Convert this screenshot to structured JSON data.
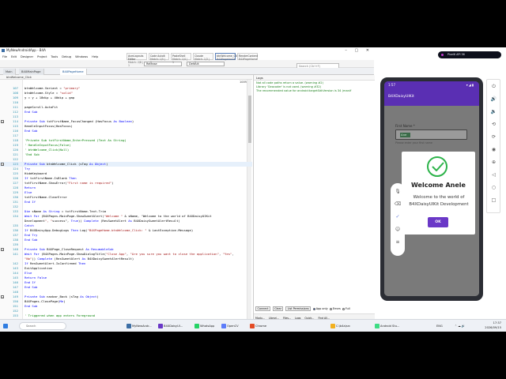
{
  "ide": {
    "title": "MyNewAndroidApp - B4A",
    "menu": [
      "File",
      "Edit",
      "Designer",
      "Project",
      "Tools",
      "Debug",
      "Windows",
      "Help"
    ],
    "device_combo": "Release",
    "variant_combo": "Default",
    "search_placeholder": "Search (Ctrl+F)",
    "doc_tabs": [
      "Main",
      "B4XMainPage",
      "B4XPageHome"
    ],
    "find_results": [
      {
        "name": "AsmLayouts Editor",
        "sub": "Match: 2/8 | 1"
      },
      {
        "name": "Code AutoIt",
        "sub": "Match: 1/5 | 1"
      },
      {
        "name": "PasteShell",
        "sub": "Match: 1/4 | 1"
      },
      {
        "name": "Claude",
        "sub": "Match: 1/3 | 1"
      },
      {
        "name": "btnWelcome_Click",
        "sub": "B4XPageHome"
      },
      {
        "name": "RenderContent",
        "sub": "B4XPageHome"
      }
    ],
    "member_bar": "btnWelcome_Click",
    "zoom": "100%"
  },
  "code": [
    {
      "ln": "107",
      "text": "    btnWelcome.Variant = \"primary\""
    },
    {
      "ln": "108",
      "text": "    btnWelcome.Style = \"solid\""
    },
    {
      "ln": "109",
      "text": "    y = y + 18dip + 40dip + gap"
    },
    {
      "ln": "110",
      "text": ""
    },
    {
      "ln": "111",
      "text": "    pageScroll.AutoFit"
    },
    {
      "ln": "112",
      "text": "End Sub"
    },
    {
      "ln": "113",
      "text": ""
    },
    {
      "ln": "114",
      "text": "Private Sub txtFirstName_FocusChanged (HasFocus As Boolean)"
    },
    {
      "ln": "115",
      "text": "    HandleInputFocus(HasFocus)"
    },
    {
      "ln": "116",
      "text": "End Sub"
    },
    {
      "ln": "117",
      "text": ""
    },
    {
      "ln": "118",
      "text": "'Private Sub txtFirstName_EnterPressed (Text As String)"
    },
    {
      "ln": "119",
      "text": "'    HandleInputFocus(False)"
    },
    {
      "ln": "120",
      "text": "'    btnWelcome_Click(Null)"
    },
    {
      "ln": "121",
      "text": "'End Sub"
    },
    {
      "ln": "122",
      "text": ""
    },
    {
      "ln": "123",
      "text": "Private Sub btnWelcome_Click (sTag As Object)"
    },
    {
      "ln": "124",
      "text": "    Try"
    },
    {
      "ln": "125",
      "text": "        HideKeyboard"
    },
    {
      "ln": "126",
      "text": "        If txtFirstName.IsBlank Then"
    },
    {
      "ln": "127",
      "text": "            txtFirstName.ShowError(\"First name is required\")"
    },
    {
      "ln": "128",
      "text": "            Return"
    },
    {
      "ln": "129",
      "text": "        Else"
    },
    {
      "ln": "130",
      "text": "            txtFirstName.ClearError"
    },
    {
      "ln": "131",
      "text": "        End If"
    },
    {
      "ln": "132",
      "text": ""
    },
    {
      "ln": "133",
      "text": "        Dim sName As String = txtFirstName.Text.Trim"
    },
    {
      "ln": "134",
      "text": "        Wait For (B4XPages.MainPage.ShowSweetAlert(\"Welcome \" & sName, \"Welcome to the world of B4XDaisyUIKit"
    },
    {
      "ln": "",
      "text": "Development\", \"success\", True)) Complete (ResSweetAlert As B4XDaisySweetAlertResult)"
    },
    {
      "ln": "135",
      "text": "    Catch"
    },
    {
      "ln": "136",
      "text": "        If B4XDaisyApp.DebugLogs Then Log(\"B4XPageHome.btnWelcome_Click: \" & LastException.Message)"
    },
    {
      "ln": "137",
      "text": "    End Try"
    },
    {
      "ln": "138",
      "text": "End Sub"
    },
    {
      "ln": "139",
      "text": ""
    },
    {
      "ln": "140",
      "text": "Private Sub B4XPage_CloseRequest As ResumableSub"
    },
    {
      "ln": "141",
      "text": "    Wait For (B4XPages.MainPage.ShowDialogTitle(\"Close App\", \"Are you sure you want to close the application\", \"Yes\","
    },
    {
      "ln": "",
      "text": "\"No\")) Complete (ResSweetAlert As B4XDaisySweetAlertResult)"
    },
    {
      "ln": "142",
      "text": "    If ResSweetAlert.IsConfirmed Then"
    },
    {
      "ln": "143",
      "text": "        ExitApplication"
    },
    {
      "ln": "144",
      "text": "    Else"
    },
    {
      "ln": "145",
      "text": "        Return False"
    },
    {
      "ln": "146",
      "text": "    End If"
    },
    {
      "ln": "147",
      "text": "End Sub"
    },
    {
      "ln": "148",
      "text": ""
    },
    {
      "ln": "149",
      "text": "Private Sub navbar_Back (sTag As Object)"
    },
    {
      "ln": "150",
      "text": "    B4XPages.ClosePage(Me)"
    },
    {
      "ln": "151",
      "text": "End Sub"
    },
    {
      "ln": "152",
      "text": ""
    },
    {
      "ln": "153",
      "text": "' Triggered when app enters Foreground"
    },
    {
      "ln": "154",
      "text": "Private Sub B4XPage_Foreground"
    },
    {
      "ln": "155",
      "text": "End Sub"
    }
  ],
  "logs": {
    "title": "Logs",
    "lines": [
      {
        "text": "Not all code paths return a value. (warning #2)",
        "color": "#1a7f1a"
      },
      {
        "text": "Library 'Geocoder' is not used. (warning #32)",
        "color": "#1a7f1a"
      },
      {
        "text": "The recommended value for android:targetSdkVersion is 34 (manif",
        "color": "#1a7f1a"
      }
    ],
    "buttons": [
      "Connect",
      "Clear",
      "List Permissions"
    ],
    "radios": [
      "App only",
      "Errors",
      "Full"
    ],
    "panel_tabs": [
      "Modu...",
      "Librari...",
      "Files...",
      "Logs",
      "Quick...",
      "Find All..."
    ]
  },
  "emulator": {
    "pill": "Pixel6 API 36",
    "status_time": "1:57",
    "app_title": "B4XDaisyUIKit",
    "field_label": "First Name *",
    "field_value": "Ane",
    "helper": "Please enter your first name"
  },
  "dialog": {
    "title": "Welcome Anele",
    "message": "Welcome to the world of B4XDaisyUIKit Development",
    "ok": "OK"
  },
  "taskbar": {
    "search": "Search",
    "items": [
      "MyNewAndr...",
      "B4XDaisyUI...",
      "WhatsApp",
      "OpenCV",
      "Chrome",
      "C:\\b4a\\src",
      "Android Stu..."
    ],
    "weather": "23°C",
    "lang": "ENG",
    "time": "17:37",
    "date": "2026/09/15"
  },
  "colors": {
    "accent": "#6a38c7",
    "success": "#2db34a",
    "app_bar": "#5a2fb3"
  }
}
